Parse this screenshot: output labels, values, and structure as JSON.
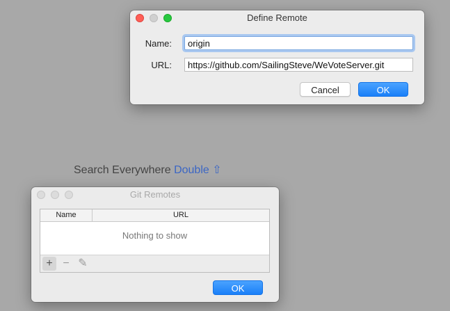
{
  "define_remote": {
    "title": "Define Remote",
    "name_label": "Name:",
    "name_value": "origin",
    "url_label": "URL:",
    "url_value": "https://github.com/SailingSteve/WeVoteServer.git",
    "cancel_label": "Cancel",
    "ok_label": "OK"
  },
  "search_hint": {
    "text": "Search Everywhere",
    "shortcut": "Double ⇧"
  },
  "git_remotes": {
    "title": "Git Remotes",
    "columns": [
      "Name",
      "URL"
    ],
    "empty_text": "Nothing to show",
    "toolbar": {
      "add": "+",
      "remove": "−",
      "edit": "✎"
    },
    "ok_label": "OK"
  }
}
